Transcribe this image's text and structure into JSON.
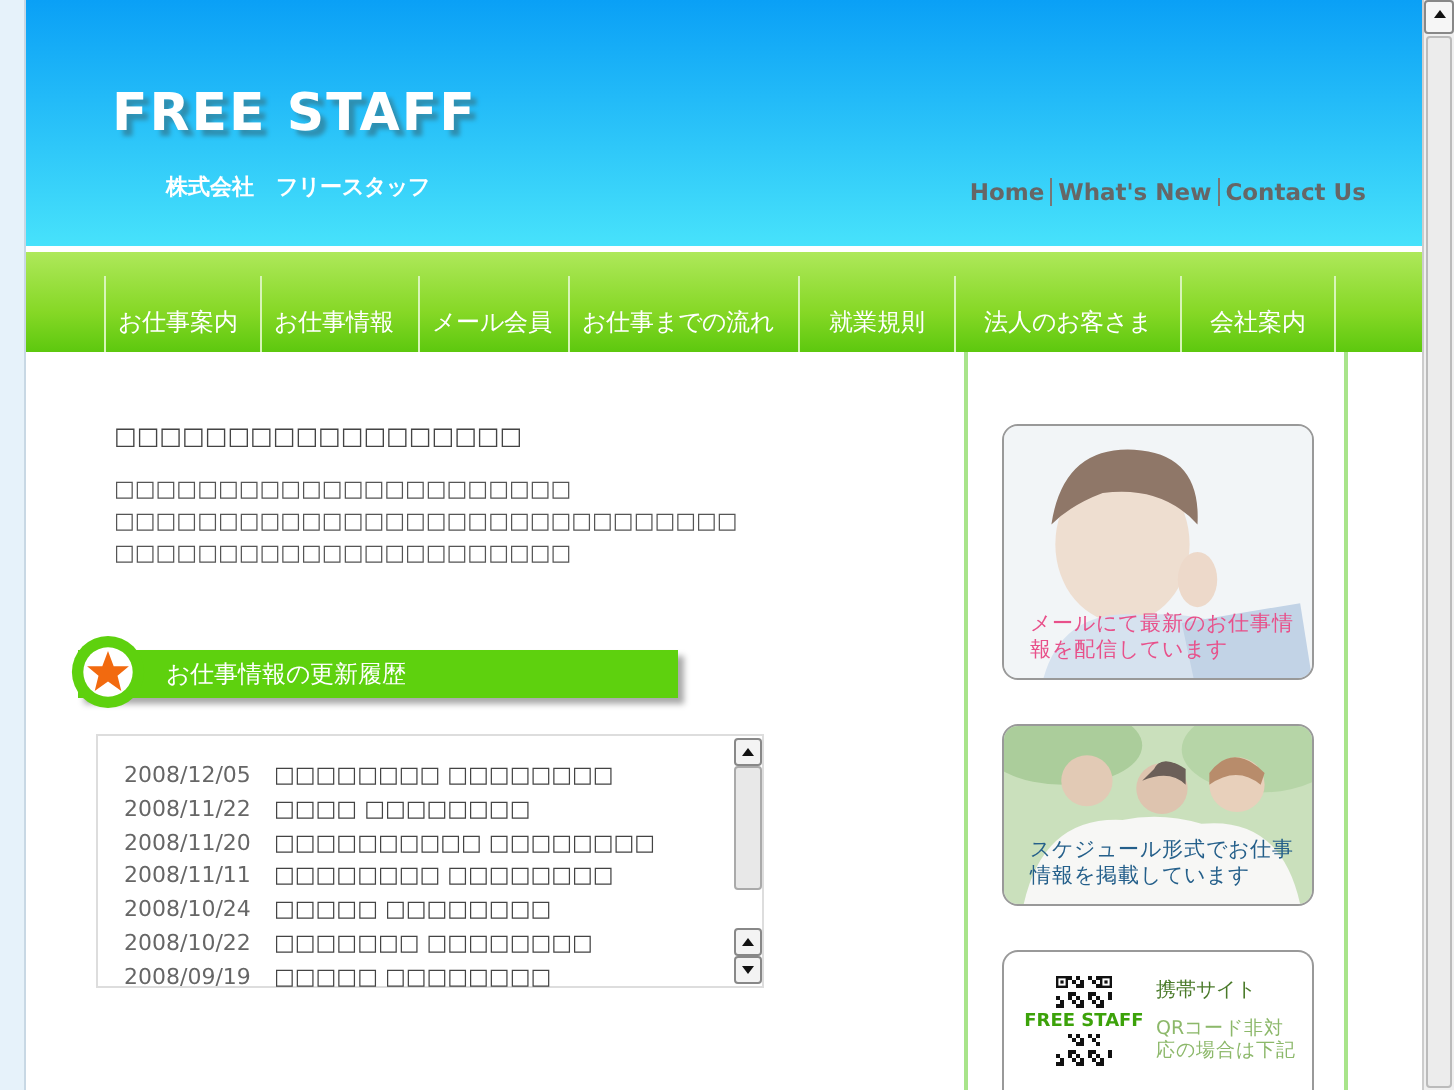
{
  "logo": {
    "title": "FREE STAFF",
    "subtitle": "株式会社　フリースタッフ"
  },
  "top_links": [
    {
      "label": "Home"
    },
    {
      "label": "What's New"
    },
    {
      "label": "Contact Us"
    }
  ],
  "nav": [
    {
      "label": "お仕事案内"
    },
    {
      "label": "お仕事情報"
    },
    {
      "label": "メール会員"
    },
    {
      "label": "お仕事までの流れ"
    },
    {
      "label": "就業規則"
    },
    {
      "label": "法人のお客さま"
    },
    {
      "label": "会社案内"
    }
  ],
  "intro": {
    "heading": "□□□□□□□□□□□□□□□□□□",
    "lines": [
      "□□□□□□□□□□□□□□□□□□□□□□",
      "□□□□□□□□□□□□□□□□□□□□□□□□□□□□□□",
      "□□□□□□□□□□□□□□□□□□□□□□"
    ]
  },
  "section_heading": "お仕事情報の更新履歴",
  "news": [
    {
      "date": "2008/12/05",
      "title": "□□□□□□□□ □□□□□□□□"
    },
    {
      "date": "2008/11/22",
      "title": "□□□□ □□□□□□□□"
    },
    {
      "date": "2008/11/20",
      "title": "□□□□□□□□□□ □□□□□□□□"
    },
    {
      "date": "2008/11/11",
      "title": "□□□□□□□□ □□□□□□□□"
    },
    {
      "date": "2008/10/24",
      "title": "□□□□□ □□□□□□□□"
    },
    {
      "date": "2008/10/22",
      "title": "□□□□□□□ □□□□□□□□"
    },
    {
      "date": "2008/09/19",
      "title": "□□□□□ □□□□□□□□"
    }
  ],
  "sidebar": [
    {
      "kind": "phone_photo",
      "caption": "メールにて最新のお仕事情報を配信しています",
      "color": "#e8508a"
    },
    {
      "kind": "group_photo",
      "caption": "スケジュール形式でお仕事情報を掲載しています",
      "color": "#245f8a"
    },
    {
      "kind": "qr",
      "qr_label": "FREE STAFF",
      "title": "携帯サイト",
      "lines": [
        "QRコード非対",
        "応の場合は下記"
      ]
    }
  ]
}
